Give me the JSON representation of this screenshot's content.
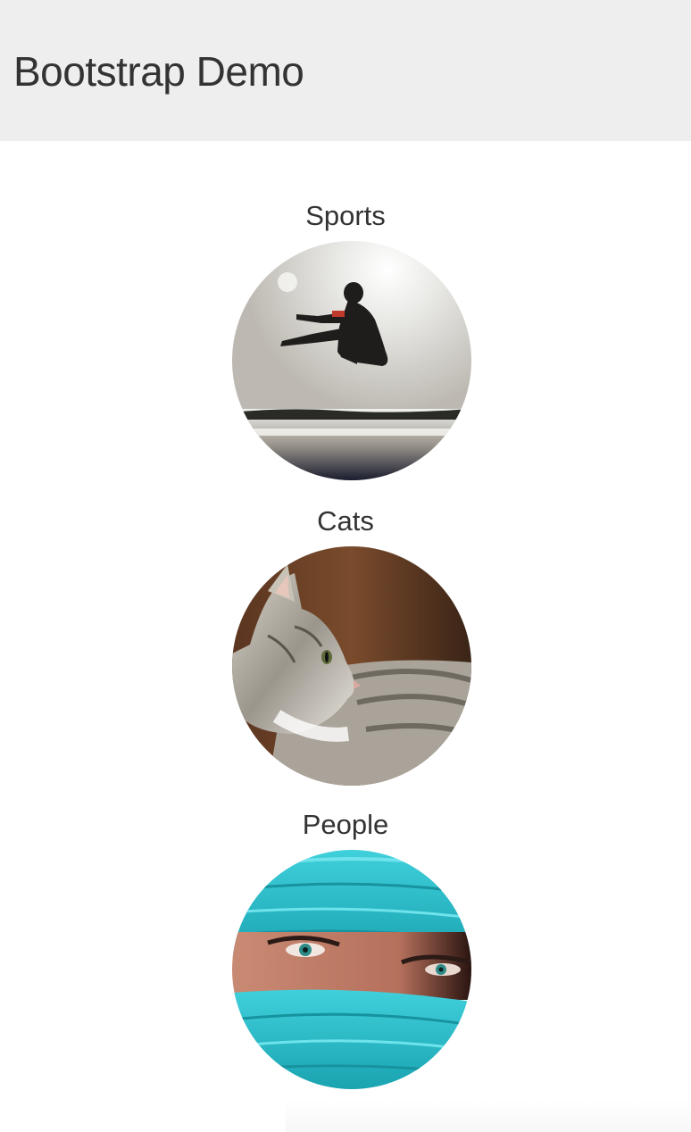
{
  "header": {
    "title": "Bootstrap Demo",
    "background": "#eeeeee"
  },
  "sections": [
    {
      "heading": "Sports",
      "image": "sports-photo"
    },
    {
      "heading": "Cats",
      "image": "cat-photo"
    },
    {
      "heading": "People",
      "image": "people-photo"
    }
  ],
  "colors": {
    "text": "#333333",
    "page_background": "#ffffff"
  }
}
